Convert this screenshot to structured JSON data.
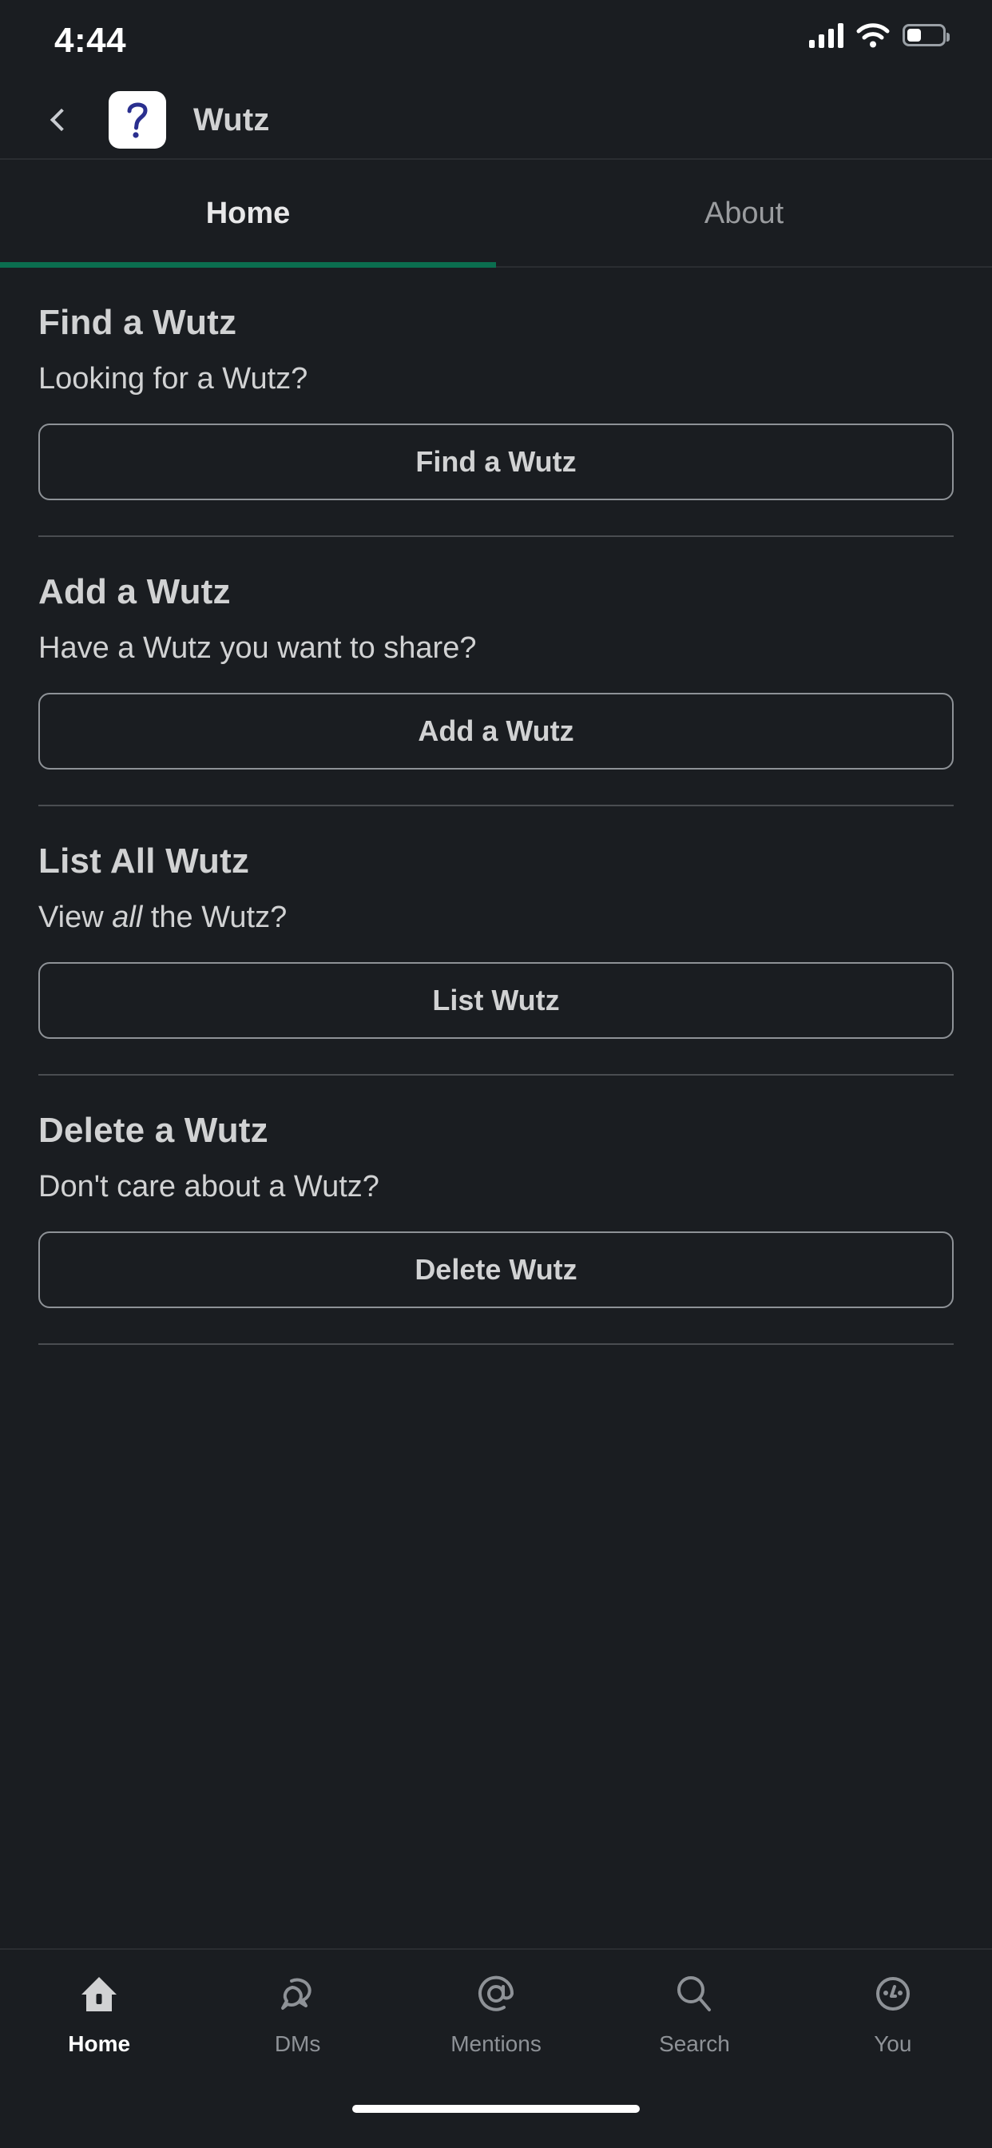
{
  "status_bar": {
    "time": "4:44",
    "icons": {
      "signal": "cellular-signal-icon",
      "wifi": "wifi-icon",
      "battery": "battery-icon"
    },
    "battery_level_pct": 35
  },
  "app_bar": {
    "back": "back-chevron-icon",
    "app_icon": "question-mark-app-icon",
    "title": "Wutz"
  },
  "tabs": {
    "items": [
      {
        "label": "Home",
        "active": true
      },
      {
        "label": "About",
        "active": false
      }
    ],
    "active_color": "#0b6e4f"
  },
  "home_sections": [
    {
      "title": "Find a Wutz",
      "subtitle_prefix": "Looking for a Wutz?",
      "subtitle_italic": "",
      "subtitle_suffix": "",
      "button": "Find a Wutz"
    },
    {
      "title": "Add a Wutz",
      "subtitle_prefix": "Have a Wutz you want to share?",
      "subtitle_italic": "",
      "subtitle_suffix": "",
      "button": "Add a Wutz"
    },
    {
      "title": "List All Wutz",
      "subtitle_prefix": "View ",
      "subtitle_italic": "all",
      "subtitle_suffix": " the Wutz?",
      "button": "List Wutz"
    },
    {
      "title": "Delete a Wutz",
      "subtitle_prefix": "Don't care about a Wutz?",
      "subtitle_italic": "",
      "subtitle_suffix": "",
      "button": "Delete Wutz"
    }
  ],
  "bottom_nav": {
    "items": [
      {
        "label": "Home",
        "icon": "home-icon",
        "active": true
      },
      {
        "label": "DMs",
        "icon": "dms-icon",
        "active": false
      },
      {
        "label": "Mentions",
        "icon": "mentions-icon",
        "active": false
      },
      {
        "label": "Search",
        "icon": "search-icon",
        "active": false
      },
      {
        "label": "You",
        "icon": "you-face-icon",
        "active": false
      }
    ]
  },
  "colors": {
    "background": "#1a1d21",
    "text_primary": "#d1d2d3",
    "text_muted": "#8e9297",
    "accent_green": "#0b6e4f",
    "app_icon_mark": "#2a2f8f"
  }
}
